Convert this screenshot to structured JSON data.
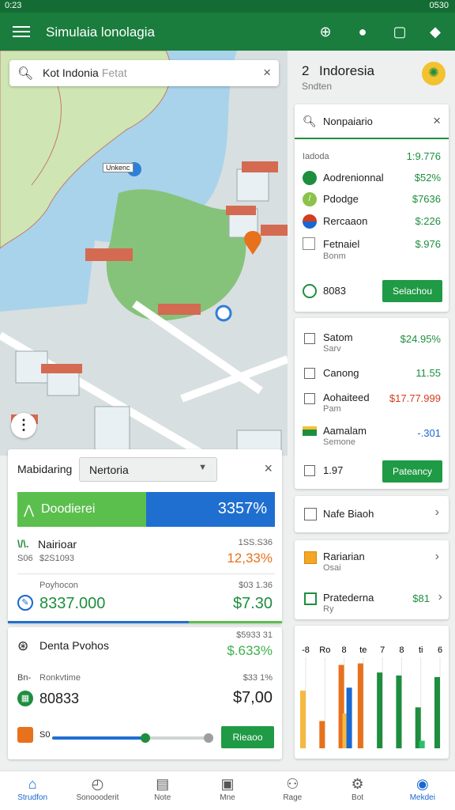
{
  "status": {
    "left": "0:23",
    "right": "0530"
  },
  "appbar": {
    "title": "Simulaia lonolagia"
  },
  "map": {
    "search_text": "Kot Indonia",
    "search_hint": "Fetat",
    "pin_label": "Unkenc"
  },
  "right_header": {
    "title": "Indoresia",
    "subtitle": "Sndten",
    "badge": "2"
  },
  "list_card": {
    "search_value": "Nonpaiario",
    "rows": [
      {
        "label": "Iadoda",
        "value": "1:9.776",
        "color": "#1e8e3e"
      },
      {
        "label": "Aodrenionnal",
        "value": "$52%",
        "color": "#1e8e3e"
      },
      {
        "label": "Pdodge",
        "value": "$7636",
        "color": "#1e8e3e"
      },
      {
        "label": "Rercaaon",
        "value": "$:226",
        "color": "#1e8e3e"
      },
      {
        "label": "Fetnaiel",
        "sub": "Bonm",
        "value": "$.976",
        "color": "#1e8e3e"
      }
    ],
    "footer_value": "8083",
    "button": "Selachou"
  },
  "stats_card": {
    "rows": [
      {
        "label": "Satom",
        "sub": "Sarv",
        "value": "$24.95%",
        "color": "#1e8e3e"
      },
      {
        "label": "Canong",
        "value": "11.55",
        "color": "#1e8e3e"
      },
      {
        "label": "Aohaiteed",
        "sub": "Pam",
        "value": "$17.77.999",
        "color": "#d33c1f"
      },
      {
        "label": "Aamalam",
        "sub": "Semone",
        "value": "-.301",
        "color": "#1967d2"
      }
    ],
    "footer_value": "1.97",
    "button": "Pateancy"
  },
  "nav_card": {
    "label": "Nafe Biaoh"
  },
  "info_card": {
    "row1_label": "Rariarian",
    "row1_sub": "Osai",
    "row2_label": "Pratederna",
    "row2_sub": "Ry",
    "row2_value": "$81"
  },
  "chart_card": {
    "labels": [
      "-8",
      "Ro",
      "8",
      "te",
      "7",
      "8",
      "ti",
      "6"
    ]
  },
  "chart_data": {
    "type": "bar",
    "categories": [
      "-8",
      "Ro",
      "8",
      "te",
      "7",
      "8",
      "ti",
      "6"
    ],
    "series": [
      {
        "values": [
          0,
          1.8,
          5.5,
          5.6,
          0,
          0,
          0,
          0
        ],
        "color": "#e8711c"
      },
      {
        "values": [
          3.8,
          0,
          2.3,
          0,
          0,
          0,
          0,
          0
        ],
        "color": "#f5b942"
      },
      {
        "values": [
          0,
          0,
          4.0,
          0,
          0,
          0,
          0,
          0
        ],
        "color": "#1967d2"
      },
      {
        "values": [
          0,
          0,
          0,
          0,
          5.0,
          4.8,
          2.7,
          4.7
        ],
        "color": "#1e8e3e"
      },
      {
        "values": [
          0,
          0,
          0,
          0,
          0,
          0,
          0.5,
          0
        ],
        "color": "#2ac06b"
      }
    ]
  },
  "bottom_sheet": {
    "label": "Mabidaring",
    "dropdown": "Nertoria",
    "progress_label": "Doodierei",
    "progress_value": "3357%",
    "progress_fraction": 0.5,
    "row1_title": "Nairioar",
    "row1_code": "S06",
    "row1_amount": "$2S1093",
    "row1_right_top": "1SS.S36",
    "row1_right_value": "12,33%",
    "row2_title": "Poyhocon",
    "row2_value": "8337.000",
    "row2_right_top": "$03 1.36",
    "row2_right_value": "$7.30"
  },
  "bottom_sheet2": {
    "title": "Denta Pvohos",
    "right_top": "$5933 31",
    "right_value": "$.633%",
    "code": "Bn-",
    "sub_label": "Ronkvtime",
    "right_mid": "$33 1%",
    "value": "80833",
    "amount": "$7,00",
    "slider_label": "S0",
    "slider_fraction": 0.6,
    "button": "Rieaoo"
  },
  "bottomnav": {
    "items": [
      {
        "label": "Strudfon",
        "icon": "home-icon",
        "glyph": "⌂"
      },
      {
        "label": "Sonoooderit",
        "icon": "clock-icon",
        "glyph": "◴"
      },
      {
        "label": "Note",
        "icon": "note-icon",
        "glyph": "▤"
      },
      {
        "label": "Mne",
        "icon": "screen-icon",
        "glyph": "▣"
      },
      {
        "label": "Rage",
        "icon": "group-icon",
        "glyph": "⚇"
      },
      {
        "label": "Bot",
        "icon": "bot-icon",
        "glyph": "⚙"
      },
      {
        "label": "Mekdei",
        "icon": "profile-icon",
        "glyph": "◉"
      }
    ]
  }
}
